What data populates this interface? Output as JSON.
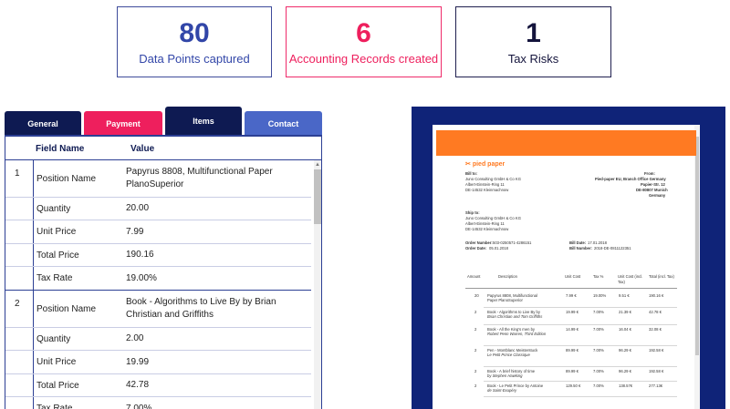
{
  "stats": [
    {
      "number": "80",
      "label": "Data Points captured"
    },
    {
      "number": "6",
      "label": "Accounting Records created"
    },
    {
      "number": "1",
      "label": "Tax Risks"
    }
  ],
  "tabs": {
    "general": "General",
    "payment": "Payment",
    "items": "Items",
    "contact": "Contact"
  },
  "table": {
    "headers": {
      "field": "Field Name",
      "value": "Value"
    },
    "groups": [
      {
        "index": "1",
        "rows": [
          {
            "field": "Position Name",
            "value": "Papyrus 8808, Multifunctional Paper PlanoSuperior"
          },
          {
            "field": "Quantity",
            "value": "20.00"
          },
          {
            "field": "Unit Price",
            "value": "7.99"
          },
          {
            "field": "Total Price",
            "value": "190.16"
          },
          {
            "field": "Tax Rate",
            "value": "19.00%"
          }
        ]
      },
      {
        "index": "2",
        "rows": [
          {
            "field": "Position Name",
            "value": "Book - Algorithms to Live By by Brian Christian and Griffiths"
          },
          {
            "field": "Quantity",
            "value": "2.00"
          },
          {
            "field": "Unit Price",
            "value": "19.99"
          },
          {
            "field": "Total Price",
            "value": "42.78"
          },
          {
            "field": "Tax Rate",
            "value": "7.00%"
          }
        ]
      }
    ]
  },
  "invoice": {
    "logo": "pied paper",
    "bill_to_label": "Bill to:",
    "bill_to": [
      "Juno Consulting GmbH & Co KG",
      "Albert-Einstein-Ring 11",
      "DE-14532 Kleinmachnow"
    ],
    "from_label": "From:",
    "from": [
      "Pied-paper EU, Branch Office Germany",
      "Papier-Str. 12",
      "DE-80807 Munich",
      "Germany"
    ],
    "ship_to_label": "Ship to:",
    "ship_to": [
      "Juno Consulting GmbH & Co KG",
      "Albert-Einstein-Ring 11",
      "DE-14532 Kleinmachnow"
    ],
    "order_number_label": "Order Number:",
    "order_number": "503-0250571-4286151",
    "order_date_label": "Order Date:",
    "order_date": "05.01.2018",
    "bill_date_label": "Bill Date:",
    "bill_date": "17.01.2018",
    "bill_number_label": "Bill Number:",
    "bill_number": "2018-DE-0811122351",
    "columns": [
      "Amount",
      "Description",
      "Unit Cost",
      "Tax %",
      "Unit Cost (incl. Tax)",
      "Total (incl. Tax)"
    ],
    "lines": [
      {
        "amount": "20",
        "desc1": "Papyrus 8808, Multifunctional",
        "desc2": "Paper PlanoSuperior",
        "unit": "7.99 €",
        "tax": "19.00%",
        "unit_incl": "9.51 €",
        "total": "190.16 €"
      },
      {
        "amount": "2",
        "desc1": "Book - Algorithms to Live By by",
        "desc2": "Brian Christian and Tom Griffiths",
        "unit": "19.99 €",
        "tax": "7.00%",
        "unit_incl": "21.39 €",
        "total": "42.78 €"
      },
      {
        "amount": "2",
        "desc1": "Book - All the King's men by",
        "desc2": "Robert Penn Warren, Third Edition",
        "unit": "14.99 €",
        "tax": "7.00%",
        "unit_incl": "16.04 €",
        "total": "32.08 €"
      },
      {
        "amount": "2",
        "desc1": "Pen - Montblanc Meisterstuck",
        "desc2": "Le Petit Prince Classique",
        "unit": "89.99 €",
        "tax": "7.00%",
        "unit_incl": "96.29 €",
        "total": "192.58 €"
      },
      {
        "amount": "2",
        "desc1": "Book - A brief history of time",
        "desc2": "by Stephen Hawking",
        "unit": "89.99 €",
        "tax": "7.00%",
        "unit_incl": "96.29 €",
        "total": "192.58 €"
      },
      {
        "amount": "2",
        "desc1": "Book - Le Petit Prince by Antoine",
        "desc2": "de Saint-Exupéry",
        "unit": "129.50 €",
        "tax": "7.00%",
        "unit_incl": "138.57€",
        "total": "277.13€"
      }
    ]
  }
}
